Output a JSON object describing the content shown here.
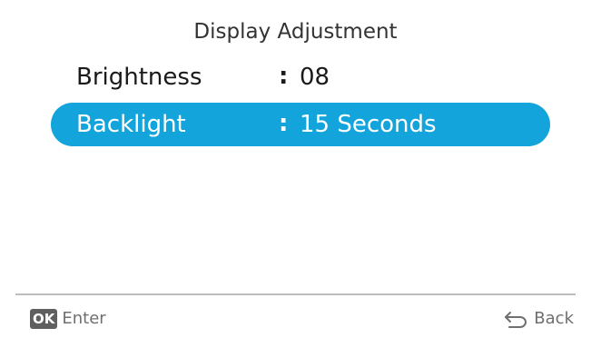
{
  "screen": {
    "title": "Display Adjustment"
  },
  "menu": {
    "items": [
      {
        "label": "Brightness",
        "separator": ":",
        "value": "08",
        "selected": false
      },
      {
        "label": "Backlight",
        "separator": ":",
        "value": "15 Seconds",
        "selected": true
      }
    ]
  },
  "footer": {
    "ok_key": "OK",
    "enter_label": "Enter",
    "back_label": "Back",
    "back_icon": "return-arrow-icon"
  },
  "colors": {
    "accent": "#12a4db",
    "text": "#1a1a1a",
    "muted": "#6f6f6f"
  }
}
